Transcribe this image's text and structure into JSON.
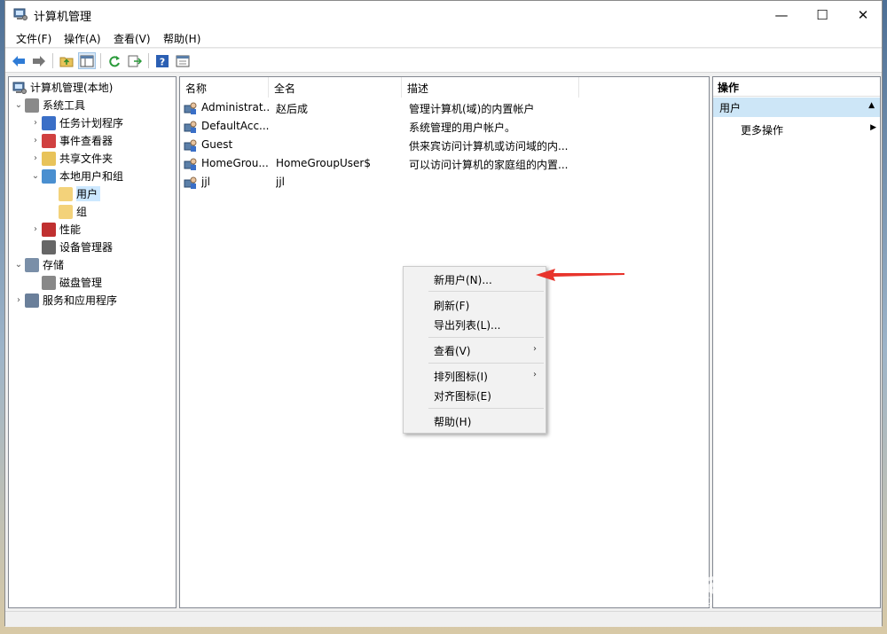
{
  "window": {
    "title": "计算机管理"
  },
  "menu": [
    "文件(F)",
    "操作(A)",
    "查看(V)",
    "帮助(H)"
  ],
  "tree": {
    "root": "计算机管理(本地)",
    "items": [
      {
        "label": "系统工具",
        "level": 1,
        "expander": "open",
        "icon": "tools-icon"
      },
      {
        "label": "任务计划程序",
        "level": 2,
        "expander": "closed",
        "icon": "clock-icon"
      },
      {
        "label": "事件查看器",
        "level": 2,
        "expander": "closed",
        "icon": "event-viewer-icon"
      },
      {
        "label": "共享文件夹",
        "level": 2,
        "expander": "closed",
        "icon": "shared-folder-icon"
      },
      {
        "label": "本地用户和组",
        "level": 2,
        "expander": "open",
        "icon": "users-group-icon"
      },
      {
        "label": "用户",
        "level": 3,
        "expander": "none",
        "icon": "folder-icon",
        "selected": true
      },
      {
        "label": "组",
        "level": 3,
        "expander": "none",
        "icon": "folder-icon"
      },
      {
        "label": "性能",
        "level": 2,
        "expander": "closed",
        "icon": "performance-icon"
      },
      {
        "label": "设备管理器",
        "level": 2,
        "expander": "none",
        "icon": "device-manager-icon"
      },
      {
        "label": "存储",
        "level": 1,
        "expander": "open",
        "icon": "storage-icon"
      },
      {
        "label": "磁盘管理",
        "level": 2,
        "expander": "none",
        "icon": "disk-icon"
      },
      {
        "label": "服务和应用程序",
        "level": 1,
        "expander": "closed",
        "icon": "services-icon"
      }
    ]
  },
  "list": {
    "columns": [
      "名称",
      "全名",
      "描述"
    ],
    "rows": [
      {
        "name": "Administrat...",
        "fullname": "赵后成",
        "desc": "管理计算机(域)的内置帐户"
      },
      {
        "name": "DefaultAcc...",
        "fullname": "",
        "desc": "系统管理的用户帐户。"
      },
      {
        "name": "Guest",
        "fullname": "",
        "desc": "供来宾访问计算机或访问域的内..."
      },
      {
        "name": "HomeGrou...",
        "fullname": "HomeGroupUser$",
        "desc": "可以访问计算机的家庭组的内置..."
      },
      {
        "name": "jjl",
        "fullname": "jjl",
        "desc": ""
      }
    ]
  },
  "context_menu": {
    "new_user": "新用户(N)...",
    "refresh": "刷新(F)",
    "export": "导出列表(L)...",
    "view": "查看(V)",
    "arrange": "排列图标(I)",
    "align": "对齐图标(E)",
    "help": "帮助(H)"
  },
  "actions": {
    "header": "操作",
    "section": "用户",
    "more": "更多操作"
  },
  "watermark": {
    "main": "Bai du 经验",
    "sub": "jingyan.baidu.com"
  },
  "colors": {
    "accent": "#cce8ff",
    "actions_section": "#cde6f7",
    "arrow": "#e8342c"
  }
}
